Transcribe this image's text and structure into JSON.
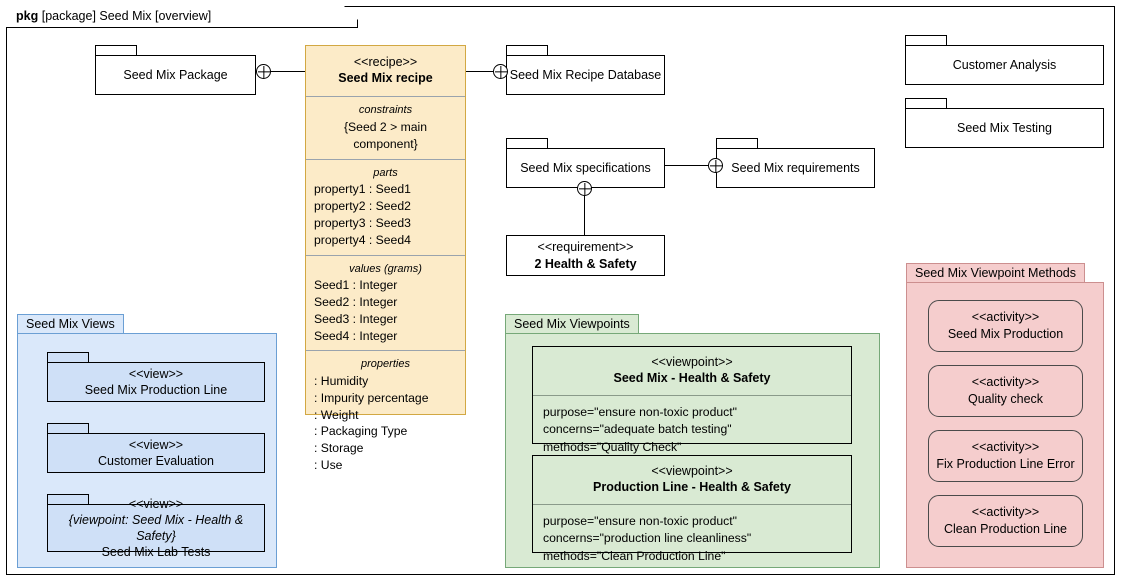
{
  "frame": {
    "keyword": "pkg",
    "label": "[package] Seed Mix [overview]"
  },
  "packages": {
    "seed_mix_package": "Seed Mix Package",
    "recipe_database": "Seed Mix Recipe Database",
    "specifications": "Seed Mix specifications",
    "requirements": "Seed Mix requirements",
    "customer_analysis": "Customer Analysis",
    "seed_mix_testing": "Seed Mix Testing"
  },
  "requirement_block": {
    "stereotype": "<<requirement>>",
    "name": "2 Health & Safety"
  },
  "recipe": {
    "stereotype": "<<recipe>>",
    "name": "Seed Mix recipe",
    "constraints": {
      "title": "constraints",
      "items": [
        "{Seed 2 > main component}"
      ]
    },
    "parts": {
      "title": "parts",
      "items": [
        "property1 : Seed1",
        "property2 : Seed2",
        "property3 : Seed3",
        "property4 : Seed4"
      ]
    },
    "values": {
      "title": "values (grams)",
      "items": [
        "Seed1 : Integer",
        "Seed2 : Integer",
        "Seed3 : Integer",
        "Seed4 : Integer"
      ]
    },
    "properties": {
      "title": "properties",
      "items": [
        ": Humidity",
        ": Impurity percentage",
        ": Weight",
        ": Packaging Type",
        ": Storage",
        ": Use"
      ]
    }
  },
  "views_panel": {
    "title": "Seed Mix Views",
    "color": "#dae8fa",
    "items": [
      {
        "stereotype": "<<view>>",
        "constraint": "",
        "name": "Seed Mix Production Line"
      },
      {
        "stereotype": "<<view>>",
        "constraint": "",
        "name": "Customer Evaluation"
      },
      {
        "stereotype": "<<view>>",
        "constraint": "{viewpoint: Seed Mix - Health & Safety}",
        "name": "Seed Mix Lab Tests"
      }
    ]
  },
  "viewpoints_panel": {
    "title": "Seed Mix Viewpoints",
    "color": "#d9ead3",
    "items": [
      {
        "stereotype": "<<viewpoint>>",
        "name": "Seed Mix - Health & Safety",
        "purpose": "purpose=\"ensure non-toxic product\"",
        "concerns": "concerns=\"adequate batch testing\"",
        "methods": "methods=\"Quality Check\""
      },
      {
        "stereotype": "<<viewpoint>>",
        "name": "Production Line - Health & Safety",
        "purpose": "purpose=\"ensure non-toxic product\"",
        "concerns": "concerns=\"production line cleanliness\"",
        "methods": "methods=\"Clean Production Line\""
      }
    ]
  },
  "methods_panel": {
    "title": "Seed Mix Viewpoint Methods",
    "color": "#f5cdcd",
    "items": [
      {
        "stereotype": "<<activity>>",
        "name": "Seed Mix Production"
      },
      {
        "stereotype": "<<activity>>",
        "name": "Quality check"
      },
      {
        "stereotype": "<<activity>>",
        "name": "Fix Production Line Error"
      },
      {
        "stereotype": "<<activity>>",
        "name": "Clean Production Line"
      }
    ]
  }
}
